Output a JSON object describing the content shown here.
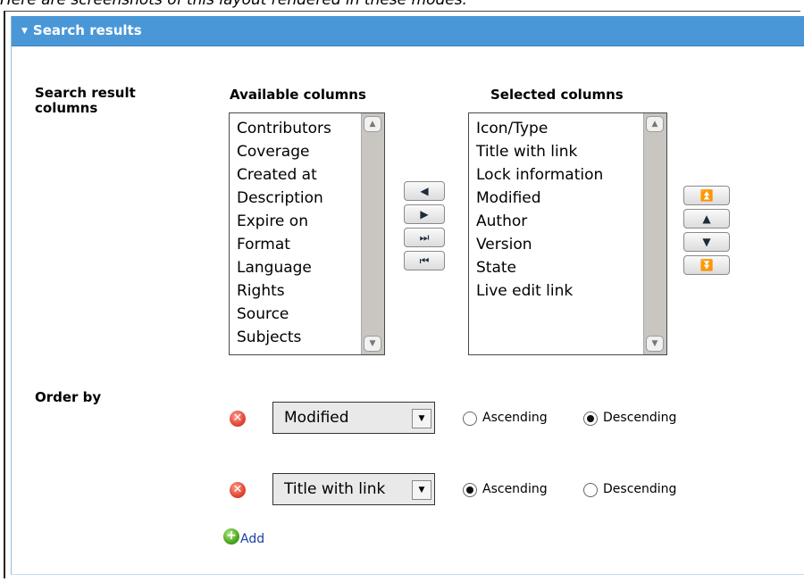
{
  "caption": "Here are screenshots of this layout rendered in these modes:",
  "panel": {
    "title": "Search results",
    "collapse_icon": "triangle-down-icon",
    "header_color": "#4a97d8"
  },
  "columns_section": {
    "label": "Search result columns",
    "available_heading": "Available columns",
    "selected_heading": "Selected columns",
    "available": [
      "Contributors",
      "Coverage",
      "Created at",
      "Description",
      "Expire on",
      "Format",
      "Language",
      "Rights",
      "Source",
      "Subjects"
    ],
    "selected": [
      "Icon/Type",
      "Title with link",
      "Lock information",
      "Modified",
      "Author",
      "Version",
      "State",
      "Live edit link"
    ]
  },
  "transfer_buttons": {
    "move_right": "▶",
    "move_left": "◀",
    "move_all_right": "⏭",
    "move_all_left": "⏮"
  },
  "order_buttons": {
    "top": "⏫",
    "up": "▲",
    "down": "▼",
    "bottom": "⏬"
  },
  "order_section": {
    "label": "Order by",
    "rows": [
      {
        "field": "Modified",
        "direction": "Descending"
      },
      {
        "field": "Title with link",
        "direction": "Ascending"
      }
    ],
    "ascending_label": "Ascending",
    "descending_label": "Descending",
    "add_label": "Add"
  }
}
